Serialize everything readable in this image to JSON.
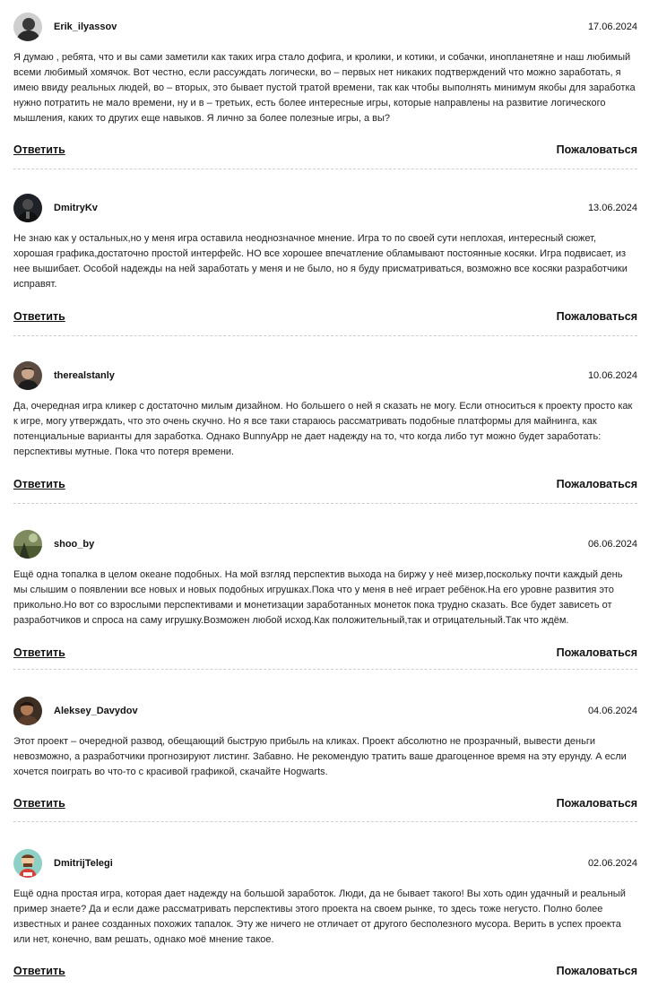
{
  "reply_label": "Ответить",
  "report_label": "Пожаловаться",
  "comments": [
    {
      "author": "Erik_ilyassov",
      "date": "17.06.2024",
      "avatar": "dark-portrait-avatar",
      "text": "Я думаю , ребята, что и вы сами заметили как таких игра стало дофига, и кролики, и котики, и собачки, инопланетяне и наш любимый всеми любимый хомячок. Вот честно, если рассуждать логически, во – первых нет никаких подтверждений что можно заработать, я имею ввиду реальных людей, во – вторых, это бывает пустой тратой времени, так как чтобы выполнять минимум якобы для заработка нужно потратить не мало времени, ну и в – третьих, есть более интересные игры, которые направлены на развитие логического мышления, каких то других еще навыков. Я лично за более полезные игры, а вы?"
    },
    {
      "author": "DmitryKv",
      "date": "13.06.2024",
      "avatar": "dark-suit-avatar",
      "text": "Не знаю как у остальных,но у меня игра оставила неоднозначное мнение. Игра то по своей сути неплохая, интересный сюжет, хорошая графика,достаточно простой интерфейс. НО все хорошее впечатление обламывают постоянные косяки. Игра подвисает, из нее вышибает. Особой надежды на ней заработать у меня и не было, но я буду присматриваться, возможно все косяки разработчики исправят."
    },
    {
      "author": "therealstanly",
      "date": "10.06.2024",
      "avatar": "man-portrait-avatar",
      "text": "Да, очередная игра кликер с достаточно милым дизайном. Но большего о ней я сказать не могу. Если относиться к проекту просто как к игре, могу утверждать, что это очень скучно. Но я все таки стараюсь рассматривать подобные платформы для майнинга, как потенциальные варианты для заработка. Однако BunnyApp не дает надежду на то, что когда либо тут можно будет заработать: перспективы мутные. Пока что потеря времени."
    },
    {
      "author": "shoo_by",
      "date": "06.06.2024",
      "avatar": "outdoor-avatar",
      "text": "Ещё одна топалка в целом океане подобных. На мой взгляд перспектив выхода на биржу у неё мизер,поскольку почти каждый день мы слышим о появлении все новых и новых подобных игрушках.Пока что у меня в неё играет ребёнок.На его уровне развития это прикольно.Но вот со взрослыми перспективами и монетизации заработанных монеток пока трудно сказать. Все будет зависеть от разработчиков и спроса на саму игрушку.Возможен любой исход.Как положительный,так и отрицательный.Так что ждём."
    },
    {
      "author": "Aleksey_Davydov",
      "date": "04.06.2024",
      "avatar": "brown-portrait-avatar",
      "text": "Этот проект – очередной развод, обещающий быструю прибыль на кликах. Проект абсолютно не прозрачный, вывести деньги невозможно, а разработчики прогнозируют листинг. Забавно. Не рекомендую тратить ваше драгоценное время на эту ерунду. А если хочется поиграть во что-то с красивой графикой, скачайте Hogwarts."
    },
    {
      "author": "DmitrijTelegi",
      "date": "02.06.2024",
      "avatar": "cartoon-avatar",
      "text": "Ещё одна простая игра, которая дает надежду на большой заработок. Люди, да не бывает такого! Вы хоть один удачный и реальный пример знаете? Да и если даже рассматривать перспективы этого проекта на своем рынке, то здесь тоже негусто. Полно более известных и ранее созданных похожих тапалок. Эту же ничего не отличает от другого бесполезного мусора. Верить в успех проекта или нет, конечно, вам решать, однако моё мнение такое."
    }
  ]
}
